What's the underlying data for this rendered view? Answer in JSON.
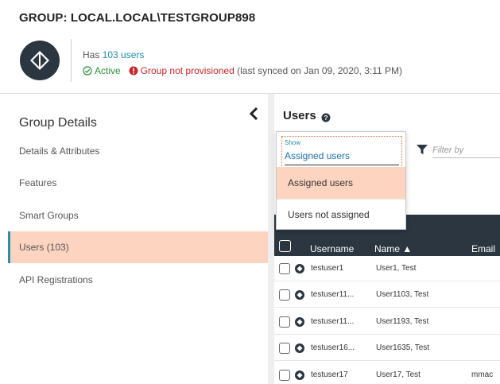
{
  "header": {
    "title": "GROUP: LOCAL.LOCAL\\TESTGROUP898",
    "has_prefix": "Has ",
    "users_link": "103 users",
    "status_active": "Active",
    "status_error": "Group not provisioned",
    "sync_text": "(last synced on Jan 09, 2020, 3:11 PM)"
  },
  "sidebar": {
    "heading": "Group Details",
    "collapse_icon": "chevron-left-icon",
    "items": [
      {
        "label": "Details & Attributes"
      },
      {
        "label": "Features"
      },
      {
        "label": "Smart Groups"
      },
      {
        "label": "Users (103)",
        "active": true
      },
      {
        "label": "API Registrations"
      }
    ]
  },
  "users_panel": {
    "title": "Users",
    "filter_placeholder": "Filter by",
    "show_dropdown": {
      "label": "Show",
      "selected": "Assigned users",
      "options": [
        "Assigned users",
        "Users not assigned"
      ]
    },
    "columns": {
      "username": "Username",
      "name": "Name ▲",
      "email": "Email"
    },
    "rows": [
      {
        "username": "testuser1",
        "name": "User1, Test",
        "email": ""
      },
      {
        "username": "testuser11...",
        "name": "User1103, Test",
        "email": ""
      },
      {
        "username": "testuser11...",
        "name": "User1193, Test",
        "email": ""
      },
      {
        "username": "testuser16...",
        "name": "User1635, Test",
        "email": ""
      },
      {
        "username": "testuser17",
        "name": "User17, Test",
        "email": "mmac"
      }
    ]
  },
  "colors": {
    "accent_teal": "#1f8fa6",
    "active_bg": "#fdd4c0",
    "dark_header": "#2b3640",
    "ok_green": "#2e8f3c",
    "error_red": "#c62828"
  }
}
